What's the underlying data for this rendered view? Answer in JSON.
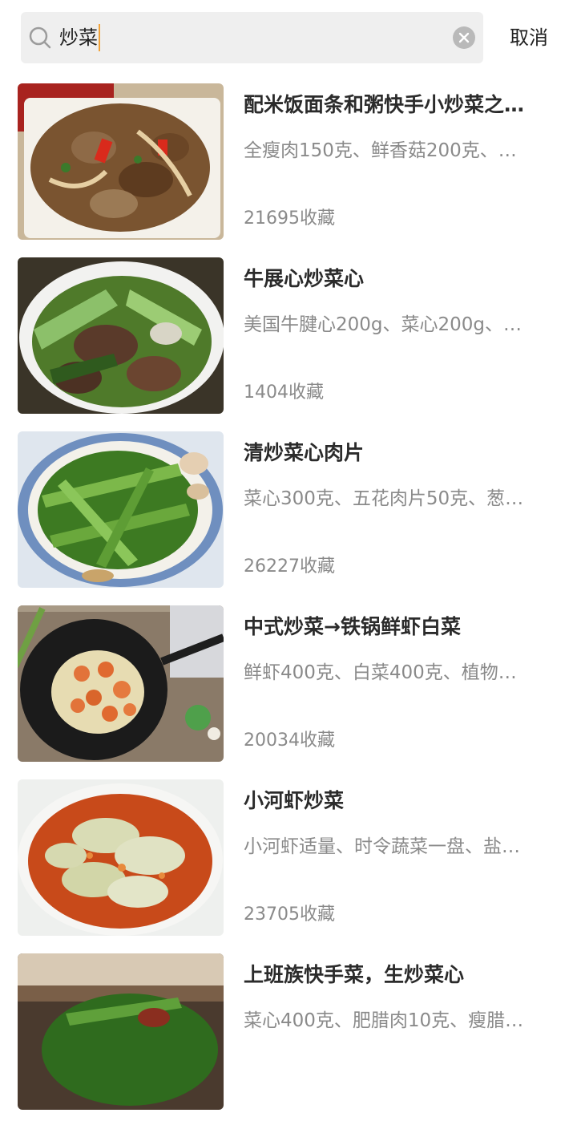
{
  "search": {
    "query": "炒菜",
    "cancel_label": "取消"
  },
  "results": [
    {
      "title": "配米饭面条和粥快手小炒菜之…",
      "ingredients": "全瘦肉150克、鲜香菇200克、…",
      "favorites": "21695收藏"
    },
    {
      "title": "牛展心炒菜心",
      "ingredients": "美国牛腱心200g、菜心200g、…",
      "favorites": "1404收藏"
    },
    {
      "title": "清炒菜心肉片",
      "ingredients": "菜心300克、五花肉片50克、葱…",
      "favorites": "26227收藏"
    },
    {
      "title": "中式炒菜→铁锅鲜虾白菜",
      "ingredients": "鲜虾400克、白菜400克、植物…",
      "favorites": "20034收藏"
    },
    {
      "title": "小河虾炒菜",
      "ingredients": "小河虾适量、时令蔬菜一盘、盐…",
      "favorites": "23705收藏"
    },
    {
      "title": "上班族快手菜，生炒菜心",
      "ingredients": "菜心400克、肥腊肉10克、瘦腊…",
      "favorites": ""
    }
  ]
}
